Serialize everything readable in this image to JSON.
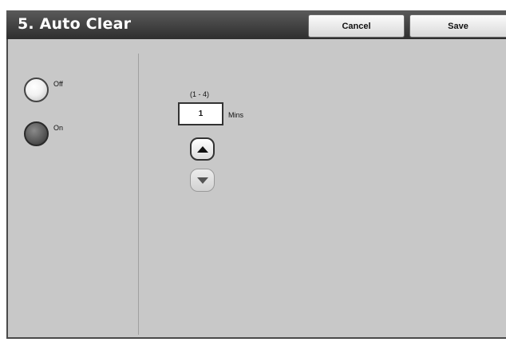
{
  "header": {
    "title": "5. Auto Clear",
    "cancel_label": "Cancel",
    "save_label": "Save"
  },
  "options": {
    "off_label": "Off",
    "on_label": "On",
    "selected": "On"
  },
  "timer": {
    "range": "(1 - 4)",
    "value": "1",
    "unit": "Mins"
  },
  "icons": {
    "increment": "triangle-up-icon",
    "decrement": "triangle-down-icon"
  }
}
